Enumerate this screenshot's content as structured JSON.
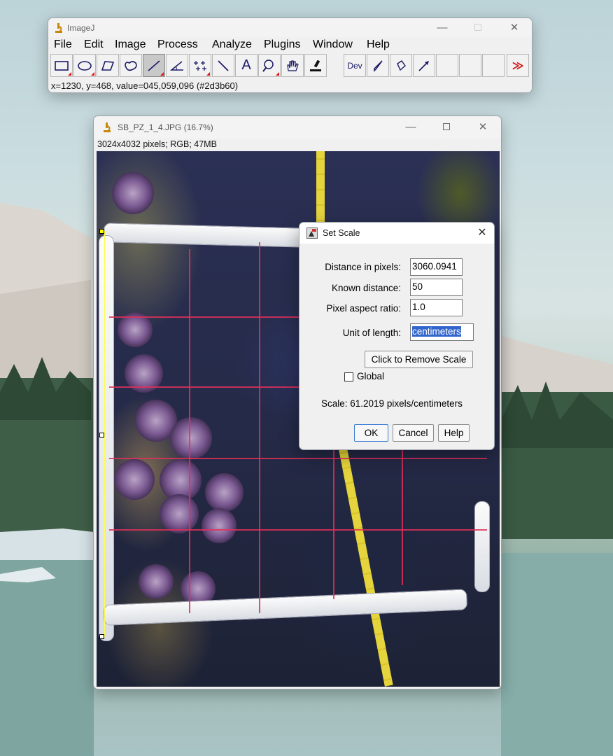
{
  "imagej": {
    "title": "ImageJ",
    "menus": [
      "File",
      "Edit",
      "Image",
      "Process",
      "Analyze",
      "Plugins",
      "Window",
      "Help"
    ],
    "tools": [
      {
        "name": "rectangle-tool-icon"
      },
      {
        "name": "oval-tool-icon"
      },
      {
        "name": "polygon-tool-icon"
      },
      {
        "name": "freehand-tool-icon"
      },
      {
        "name": "line-tool-icon",
        "selected": true
      },
      {
        "name": "angle-tool-icon"
      },
      {
        "name": "point-tool-icon"
      },
      {
        "name": "wand-tool-icon"
      },
      {
        "name": "text-tool-icon",
        "glyph": "A"
      },
      {
        "name": "magnifier-tool-icon"
      },
      {
        "name": "hand-tool-icon"
      },
      {
        "name": "dropper-tool-icon"
      },
      {
        "name": "developer-menu-icon",
        "glyph": "Dev"
      },
      {
        "name": "brush-tool-icon"
      },
      {
        "name": "flood-fill-tool-icon"
      },
      {
        "name": "arrow-tool-icon"
      },
      {
        "name": "empty-slot"
      },
      {
        "name": "empty-slot"
      },
      {
        "name": "empty-slot"
      },
      {
        "name": "more-tools-icon",
        "glyph": "≫"
      }
    ],
    "status": "x=1230, y=468, value=045,059,096 (#2d3b60)"
  },
  "image_window": {
    "title": "SB_PZ_1_4.JPG (16.7%)",
    "info": "3024x4032 pixels; RGB; 47MB"
  },
  "set_scale": {
    "title": "Set Scale",
    "distance_label": "Distance in pixels:",
    "distance_value": "3060.0941",
    "known_label": "Known distance:",
    "known_value": "50",
    "aspect_label": "Pixel aspect ratio:",
    "aspect_value": "1.0",
    "unit_label": "Unit of length:",
    "unit_value": "centimeters",
    "remove_button": "Click to Remove Scale",
    "global_label": "Global",
    "global_checked": false,
    "scale_text": "Scale: 61.2019 pixels/centimeters",
    "ok": "OK",
    "cancel": "Cancel",
    "help": "Help"
  },
  "colors": {
    "accent_selection": "#3366cc",
    "grid_line": "#e0305a",
    "tape": "#e5d43c",
    "tool_popup_marker": "#e01010"
  }
}
